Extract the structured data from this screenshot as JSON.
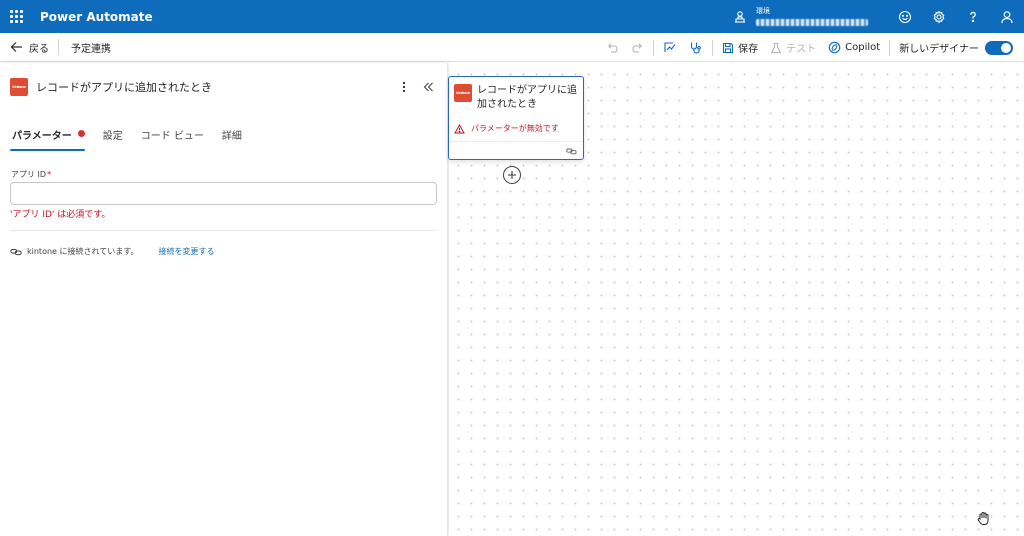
{
  "app": {
    "title": "Power Automate"
  },
  "environment": {
    "label": "環境",
    "name": ""
  },
  "toolbar": {
    "back_label": "戻る",
    "flow_name": "予定連携",
    "save_label": "保存",
    "test_label": "テスト",
    "copilot_label": "Copilot",
    "new_designer_label": "新しいデザイナー",
    "new_designer_enabled": true
  },
  "panel": {
    "title": "レコードがアプリに追加されたとき",
    "connector_logo_text": "kintone",
    "tabs": [
      {
        "label": "パラメーター",
        "active": true,
        "has_error": true
      },
      {
        "label": "設定",
        "active": false
      },
      {
        "label": "コード ビュー",
        "active": false
      },
      {
        "label": "詳細",
        "active": false
      }
    ],
    "field": {
      "label": "アプリ ID",
      "required_mark": "*",
      "value": "",
      "error": "'アプリ ID' は必須です。"
    },
    "connection": {
      "text": "kintone に接続されています。",
      "change_link": "接続を変更する"
    }
  },
  "canvas": {
    "node": {
      "title": "レコードがアプリに追加されたとき",
      "warning": "パラメーターが無効です"
    }
  },
  "colors": {
    "brand": "#0f6cbd",
    "error": "#c50f1f",
    "connector": "#e04b33",
    "node_border": "#2b66c7"
  },
  "icons": [
    "waffle-icon",
    "environment-icon",
    "smiley-icon",
    "gear-icon",
    "help-icon",
    "person-icon",
    "back-arrow-icon",
    "undo-icon",
    "redo-icon",
    "flow-checker-icon",
    "stethoscope-icon",
    "save-icon",
    "flask-icon",
    "copilot-icon",
    "more-vertical-icon",
    "collapse-icon",
    "link-icon",
    "warning-icon",
    "plus-icon",
    "hand-cursor-icon"
  ]
}
